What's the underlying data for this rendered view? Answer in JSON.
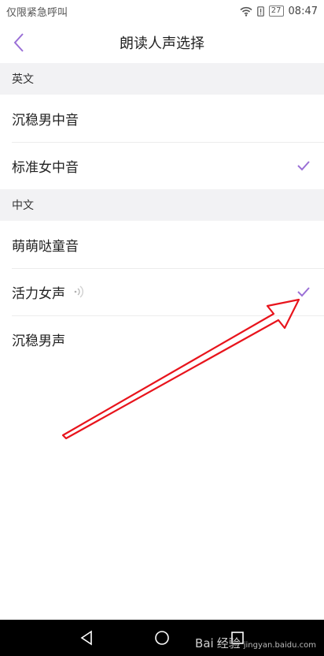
{
  "status_bar": {
    "carrier_text": "仅限紧急呼叫",
    "battery": "27",
    "time": "08:47"
  },
  "header": {
    "title": "朗读人声选择"
  },
  "sections": [
    {
      "title": "英文",
      "items": [
        {
          "label": "沉稳男中音",
          "selected": false
        },
        {
          "label": "标准女中音",
          "selected": true
        }
      ]
    },
    {
      "title": "中文",
      "items": [
        {
          "label": "萌萌哒童音",
          "selected": false
        },
        {
          "label": "活力女声",
          "selected": true,
          "playing": true
        },
        {
          "label": "沉稳男声",
          "selected": false
        }
      ]
    }
  ],
  "colors": {
    "accent": "#9a6fd6",
    "annotation": "#e8141c",
    "section_bg": "#f2f2f4"
  },
  "watermark": {
    "brand": "Bai",
    "suffix": "经验",
    "domain": "jingyan.baidu.com"
  }
}
